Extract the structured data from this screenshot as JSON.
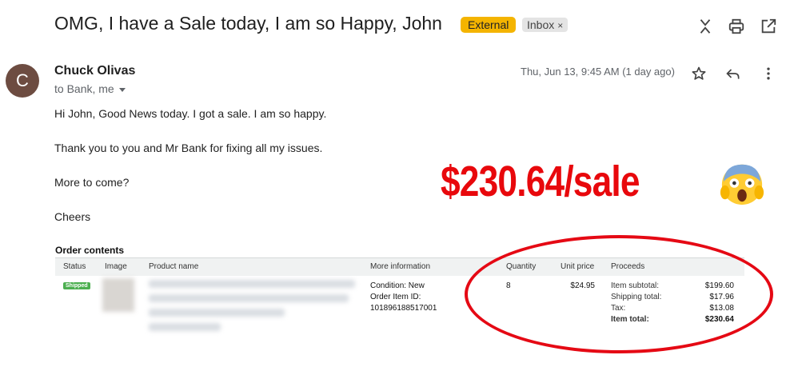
{
  "email": {
    "subject": "OMG, I have a Sale today, I am so Happy, John",
    "labels": {
      "external": "External",
      "inbox": "Inbox",
      "remove": "×"
    },
    "sender_initial": "C",
    "sender_name": "Chuck Olivas",
    "recipients": "to Bank, me",
    "date": "Thu, Jun 13, 9:45 AM (1 day ago)",
    "body": [
      "Hi John, Good News today. I got a sale. I am so happy.",
      "Thank you to you and Mr Bank for fixing all my issues.",
      "More to come?",
      "Cheers"
    ]
  },
  "overlay": {
    "promo_text": "$230.64/sale",
    "emoji_name": "screaming-face-emoji",
    "accent_color": "#e8080c"
  },
  "order": {
    "title": "Order contents",
    "headers": {
      "status": "Status",
      "image": "Image",
      "product": "Product name",
      "more": "More information",
      "quantity": "Quantity",
      "unit_price": "Unit price",
      "proceeds": "Proceeds"
    },
    "row": {
      "status": "Shipped",
      "info": [
        "Condition: New",
        "Order Item ID:",
        "101896188517001"
      ],
      "quantity": "8",
      "unit_price": "$24.95",
      "proceeds": [
        {
          "label": "Item subtotal:",
          "value": "$199.60"
        },
        {
          "label": "Shipping total:",
          "value": "$17.96"
        },
        {
          "label": "Tax:",
          "value": "$13.08"
        },
        {
          "label": "Item total:",
          "value": "$230.64"
        }
      ]
    }
  },
  "icons": [
    "expand-collapse-icon",
    "print-icon",
    "open-in-new-window-icon",
    "star-icon",
    "reply-icon",
    "more-vert-icon"
  ]
}
